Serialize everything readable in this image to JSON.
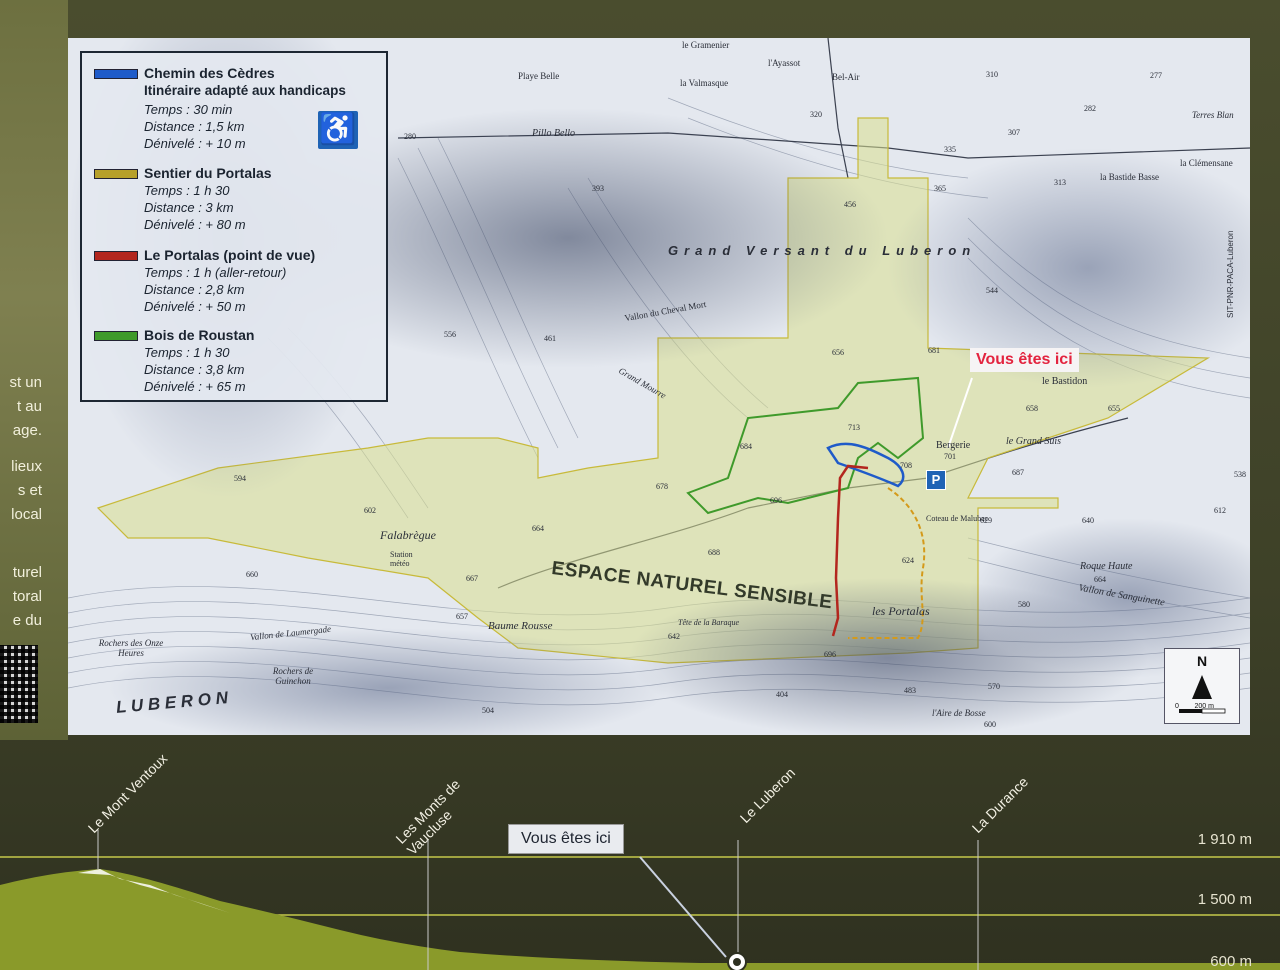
{
  "legend": {
    "items": [
      {
        "title": "Chemin des Cèdres",
        "subtitle": "Itinéraire adapté aux handicaps",
        "time": "Temps : 30 min",
        "distance": "Distance : 1,5 km",
        "elevation": "Dénivelé : + 10 m",
        "color": "#1f5bc9"
      },
      {
        "title": "Sentier du Portalas",
        "time": "Temps : 1 h 30",
        "distance": "Distance : 3 km",
        "elevation": "Dénivelé : + 80 m",
        "color": "#b7a02a"
      },
      {
        "title": "Le Portalas (point de vue)",
        "time": "Temps : 1 h (aller-retour)",
        "distance": "Distance : 2,8 km",
        "elevation": "Dénivelé : + 50 m",
        "color": "#b3261e"
      },
      {
        "title": "Bois de Roustan",
        "time": "Temps : 1 h 30",
        "distance": "Distance : 3,8 km",
        "elevation": "Dénivelé : + 65 m",
        "color": "#3f9a2b"
      }
    ],
    "accessibility_icon": "wheelchair-icon"
  },
  "map": {
    "you_are_here": "Vous êtes ici",
    "parking": "P",
    "zone_label": "ESPACE NATUREL SENSIBLE",
    "places": {
      "grand_versant": "Grand Versant du Luberon",
      "luberon": "L U B E R O N",
      "falabregue": "Falabrègue",
      "baume_rousse": "Baume Rousse",
      "les_portalas": "les Portalas",
      "le_bastidon": "le Bastidon",
      "le_grand_suis": "le Grand Suis",
      "bergerie": "Bergerie",
      "roque_haute": "Roque Haute",
      "bel_air": "Bel-Air",
      "playe_belle": "Playe Belle",
      "pillo_bello": "Pillo Bello",
      "station_meteo": "Station météo",
      "coteau_malubac": "Coteau de Malubac",
      "tete_baraque": "Tête de la Baraque",
      "la_valmasque": "la Valmasque",
      "le_gramenier": "le Gramenier",
      "l_ayassot": "l'Ayassot",
      "la_clemensane": "la Clémensane",
      "la_bastide_basse": "la Bastide Basse",
      "terres_blan": "Terres Blan",
      "vallon_laumergade": "Vallon de Laumergade",
      "rochers_onze": "Rochers des Onze Heures",
      "rochers_guinchon": "Rochers de Guinchon",
      "aire_bosse": "l'Aire de Bosse",
      "vallon_cheval_mort": "Vallon du Cheval Mort",
      "grand_mourre": "Grand Mourre",
      "vallon_sanguinette": "Vallon de Sanguinette"
    },
    "elevations": [
      "310",
      "277",
      "282",
      "307",
      "313",
      "335",
      "365",
      "393",
      "456",
      "461",
      "556",
      "594",
      "602",
      "660",
      "667",
      "657",
      "664",
      "684",
      "696",
      "713",
      "708",
      "701",
      "687",
      "656",
      "681",
      "678",
      "688",
      "642",
      "696",
      "624",
      "612",
      "640",
      "629",
      "664",
      "580",
      "544",
      "538",
      "483",
      "570",
      "600",
      "404",
      "504",
      "320",
      "280",
      "658",
      "655"
    ],
    "scale_label": "0        200 m",
    "north_label": "N",
    "credit": "SIT-PNR-PACA-Luberon"
  },
  "profile": {
    "labels": [
      "Le Mont Ventoux",
      "Les Monts de Vaucluse",
      "Le Luberon",
      "La Durance"
    ],
    "you_are_here": "Vous êtes ici",
    "altitudes": [
      "1 910 m",
      "1 500 m",
      "600 m"
    ]
  },
  "left_panel": {
    "lines": [
      "st un",
      "t au",
      "age.",
      "lieux",
      "s et",
      "local",
      "turel",
      "toral",
      "e du"
    ]
  }
}
